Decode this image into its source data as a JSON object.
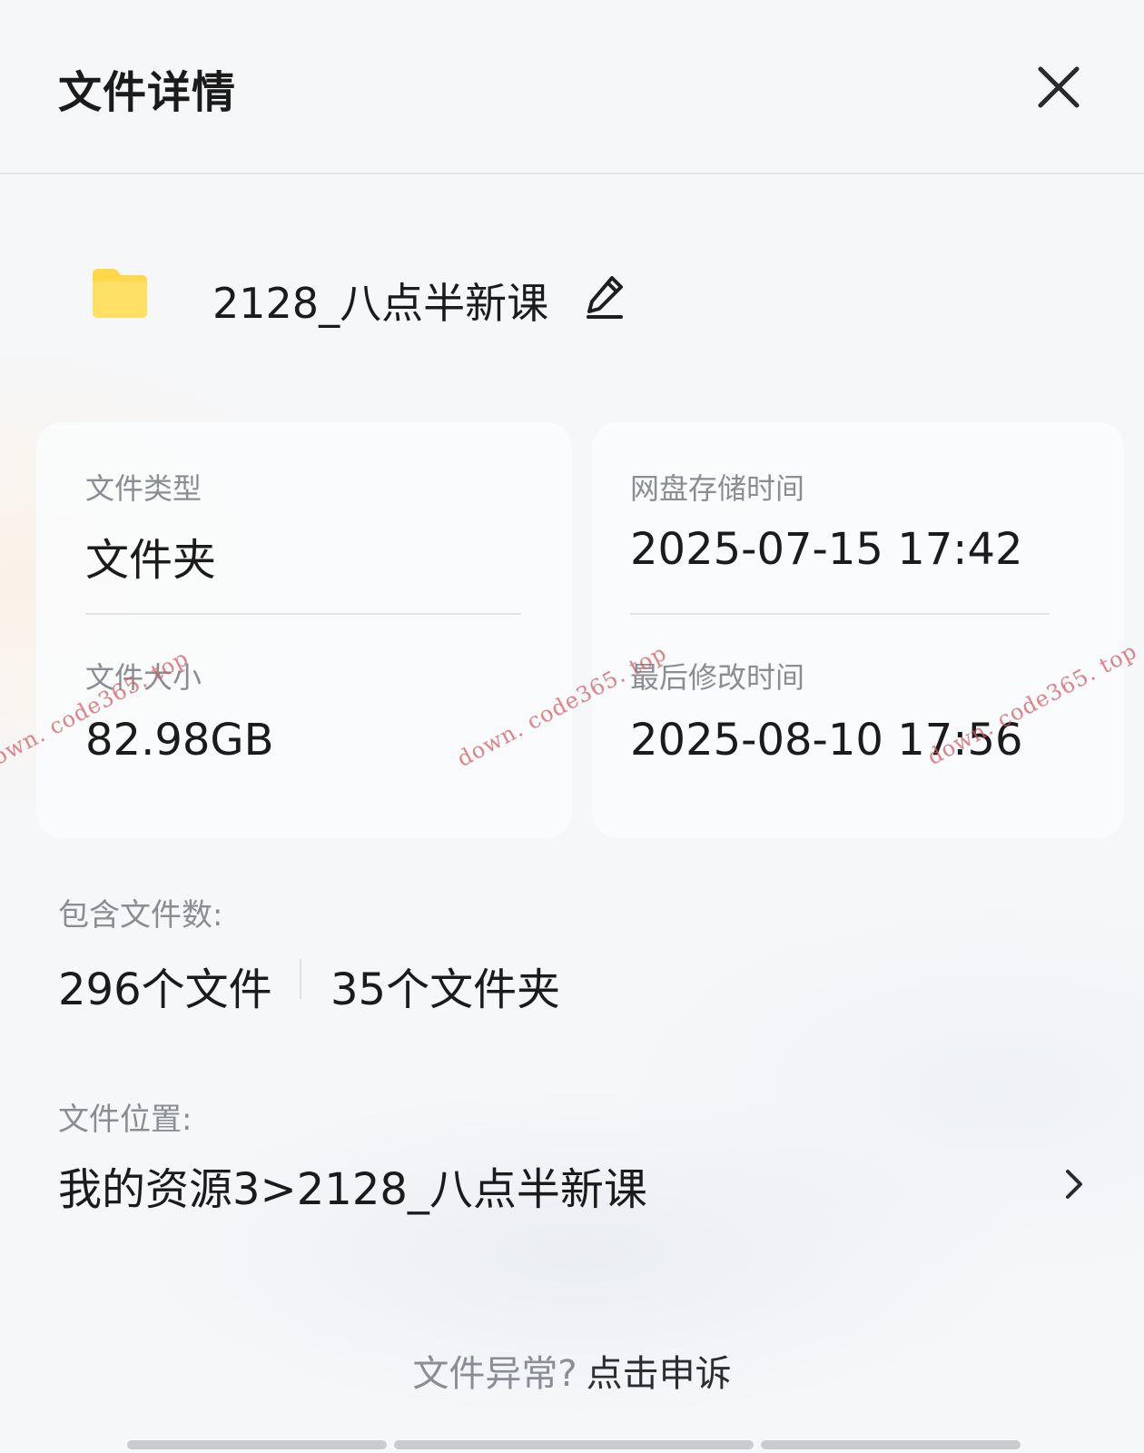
{
  "header": {
    "title": "文件详情",
    "close_icon": "close-icon"
  },
  "file": {
    "name": "2128_八点半新课",
    "icon": "folder-icon",
    "icon_color": "#FFD84A",
    "edit_icon": "pencil-icon"
  },
  "details": {
    "type_label": "文件类型",
    "type_value": "文件夹",
    "size_label": "文件大小",
    "size_value": "82.98GB",
    "stored_label": "网盘存储时间",
    "stored_value": "2025-07-15 17:42",
    "modified_label": "最后修改时间",
    "modified_value": "2025-08-10 17:56"
  },
  "contains": {
    "label": "包含文件数:",
    "files": "296个文件",
    "folders": "35个文件夹"
  },
  "location": {
    "label": "文件位置:",
    "path": "我的资源3>2128_八点半新课",
    "chevron_icon": "chevron-right-icon"
  },
  "footer": {
    "question": "文件异常?",
    "link": "点击申诉"
  },
  "watermarks": [
    "own. code365. top",
    "down. code365. top",
    "down. code365. top"
  ]
}
